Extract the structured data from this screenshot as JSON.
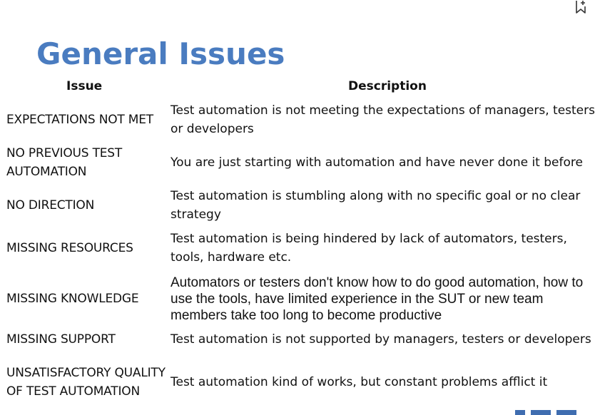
{
  "title": "General Issues",
  "table": {
    "headers": [
      "Issue",
      "Description"
    ],
    "rows": [
      {
        "issue": "EXPECTATIONS NOT MET",
        "description": "Test automation is not meeting the expectations of managers, testers or developers"
      },
      {
        "issue": "NO PREVIOUS TEST AUTOMATION",
        "description": "You are just starting with automation and have never done it before"
      },
      {
        "issue": "NO DIRECTION",
        "description": "Test automation is stumbling along with no specific goal or no clear strategy"
      },
      {
        "issue": "MISSING RESOURCES",
        "description": "Test automation is being hindered by lack of automators, testers, tools, hardware etc."
      },
      {
        "issue": "MISSING KNOWLEDGE",
        "description": "Automators or testers don't know how to do good automation, how to use the tools, have limited experience in the SUT or new team members take too long to become productive"
      },
      {
        "issue": "MISSING SUPPORT",
        "description": "Test automation is not supported by managers, testers or developers"
      },
      {
        "issue": "UNSATISFACTORY QUALITY OF TEST AUTOMATION",
        "description": "Test automation kind of works, but constant problems afflict it"
      }
    ]
  },
  "icons": {
    "bookmark": "bookmark-add-icon"
  },
  "colors": {
    "title": "#4a7cc0",
    "text": "#111111",
    "decoration": "#3f6db0"
  }
}
